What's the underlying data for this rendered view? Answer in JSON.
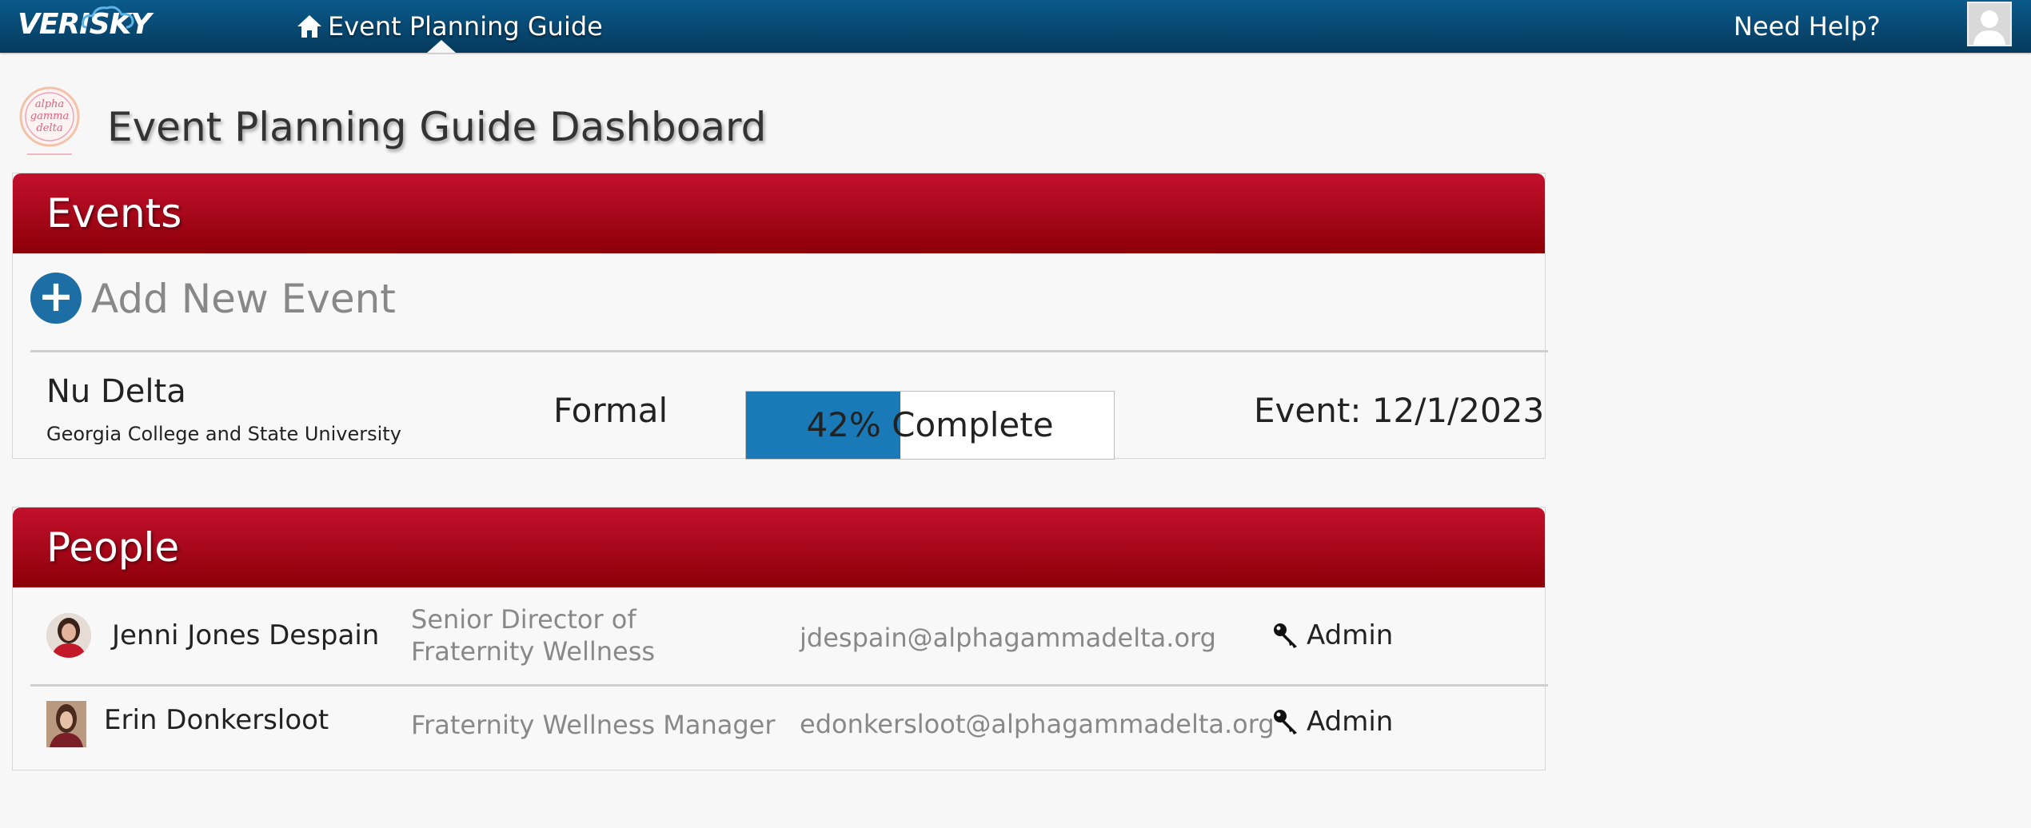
{
  "topbar": {
    "brand": "VERISKY",
    "nav_title": "Event Planning Guide",
    "help_label": "Need Help?",
    "icons": {
      "home": "home-icon",
      "avatar": "user-avatar-icon"
    }
  },
  "org_logo": {
    "text": "alpha gamma delta"
  },
  "page_title": "Event Planning Guide Dashboard",
  "events_panel": {
    "heading": "Events",
    "add_label": "Add New Event",
    "items": [
      {
        "name": "Nu Delta",
        "school": "Georgia College and State University",
        "type": "Formal",
        "progress_percent": 42,
        "progress_label": "42% Complete",
        "date_label": "Event: 12/1/2023"
      }
    ]
  },
  "people_panel": {
    "heading": "People",
    "people": [
      {
        "name": "Jenni Jones Despain",
        "title": "Senior Director of Fraternity Wellness",
        "email": "jdespain@alphagammadelta.org",
        "role": "Admin"
      },
      {
        "name": "Erin Donkersloot",
        "title": "Fraternity Wellness Manager",
        "email": "edonkersloot@alphagammadelta.org",
        "role": "Admin"
      }
    ]
  },
  "colors": {
    "nav_bg": "#063a5c",
    "panel_header_red": "#b5102a",
    "progress_blue": "#1a7ab8",
    "add_button_blue": "#1c6ea4"
  }
}
